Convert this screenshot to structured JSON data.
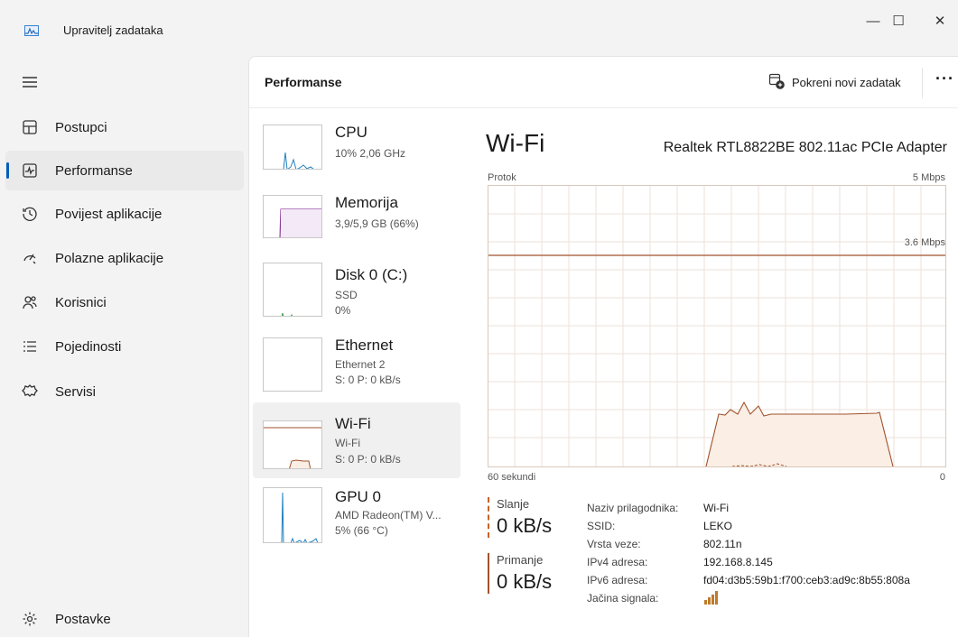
{
  "window": {
    "title": "Upravitelj zadataka",
    "controls": [
      "—",
      "☐",
      "✕"
    ]
  },
  "nav": {
    "items": [
      {
        "label": "Postupci",
        "icon": "processes-icon"
      },
      {
        "label": "Performanse",
        "icon": "performance-icon",
        "active": true
      },
      {
        "label": "Povijest aplikacije",
        "icon": "history-icon"
      },
      {
        "label": "Polazne aplikacije",
        "icon": "startup-icon"
      },
      {
        "label": "Korisnici",
        "icon": "users-icon"
      },
      {
        "label": "Pojedinosti",
        "icon": "details-icon"
      },
      {
        "label": "Servisi",
        "icon": "services-icon"
      }
    ],
    "settings_label": "Postavke"
  },
  "header": {
    "title": "Performanse",
    "new_task_label": "Pokreni novi zadatak",
    "more": "···"
  },
  "devices": [
    {
      "name": "CPU",
      "sub1": "10% 2,06 GHz",
      "sub2": ""
    },
    {
      "name": "Memorija",
      "sub1": "3,9/5,9 GB (66%)",
      "sub2": ""
    },
    {
      "name": "Disk 0 (C:)",
      "sub1": "SSD",
      "sub2": "0%"
    },
    {
      "name": "Ethernet",
      "sub1": "Ethernet 2",
      "sub2": "S: 0 P: 0 kB/s"
    },
    {
      "name": "Wi-Fi",
      "sub1": "Wi-Fi",
      "sub2": "S: 0 P: 0 kB/s",
      "active": true
    },
    {
      "name": "GPU 0",
      "sub1": "AMD Radeon(TM) V...",
      "sub2": "5% (66 °C)"
    }
  ],
  "detail": {
    "title": "Wi-Fi",
    "adapter": "Realtek RTL8822BE 802.11ac PCIe Adapter",
    "graph_label": "Protok",
    "graph_max": "5 Mbps",
    "graph_marker": "3.6 Mbps",
    "time_span": "60 sekundi",
    "zero": "0",
    "send_label": "Slanje",
    "send_value": "0 kB/s",
    "recv_label": "Primanje",
    "recv_value": "0 kB/s",
    "properties": [
      {
        "key": "Naziv prilagodnika:",
        "value": "Wi-Fi"
      },
      {
        "key": "SSID:",
        "value": "LEKO"
      },
      {
        "key": "Vrsta veze:",
        "value": "802.11n"
      },
      {
        "key": "IPv4 adresa:",
        "value": "192.168.8.145"
      },
      {
        "key": "IPv6 adresa:",
        "value": "fd04:d3b5:59b1:f700:ceb3:ad9c:8b55:808a"
      },
      {
        "key": "Jačina signala:",
        "value": ""
      }
    ],
    "signal_bars": 4
  },
  "colors": {
    "accent": "#005fb8",
    "wifi_line": "#a0522d",
    "wifi_fill": "#fbeee4",
    "cpu_line": "#1f7fc0",
    "mem_line": "#8b3a9b",
    "disk_line": "#3aa14a"
  }
}
